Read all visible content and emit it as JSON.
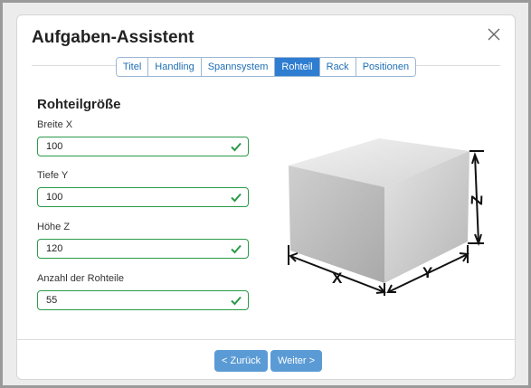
{
  "dialog": {
    "title": "Aufgaben-Assistent",
    "close_icon": "close-icon"
  },
  "tabs": [
    {
      "label": "Titel",
      "active": false
    },
    {
      "label": "Handling",
      "active": false
    },
    {
      "label": "Spannsystem",
      "active": false
    },
    {
      "label": "Rohteil",
      "active": true
    },
    {
      "label": "Rack",
      "active": false
    },
    {
      "label": "Positionen",
      "active": false
    }
  ],
  "section": {
    "title": "Rohteilgröße"
  },
  "fields": {
    "width": {
      "label": "Breite X",
      "value": "100",
      "valid": true
    },
    "depth": {
      "label": "Tiefe Y",
      "value": "100",
      "valid": true
    },
    "height": {
      "label": "Höhe Z",
      "value": "120",
      "valid": true
    },
    "count": {
      "label": "Anzahl der Rohteile",
      "value": "55",
      "valid": true
    }
  },
  "figure": {
    "axis_x": "X",
    "axis_y": "Y",
    "axis_z": "Z"
  },
  "footer": {
    "back_label": "Zurück",
    "next_label": "Weiter",
    "back_icon": "chevron-left-icon",
    "next_icon": "chevron-right-icon"
  },
  "colors": {
    "accent": "#2f7dd1",
    "button": "#5b9bd5",
    "valid": "#2a9a48"
  }
}
